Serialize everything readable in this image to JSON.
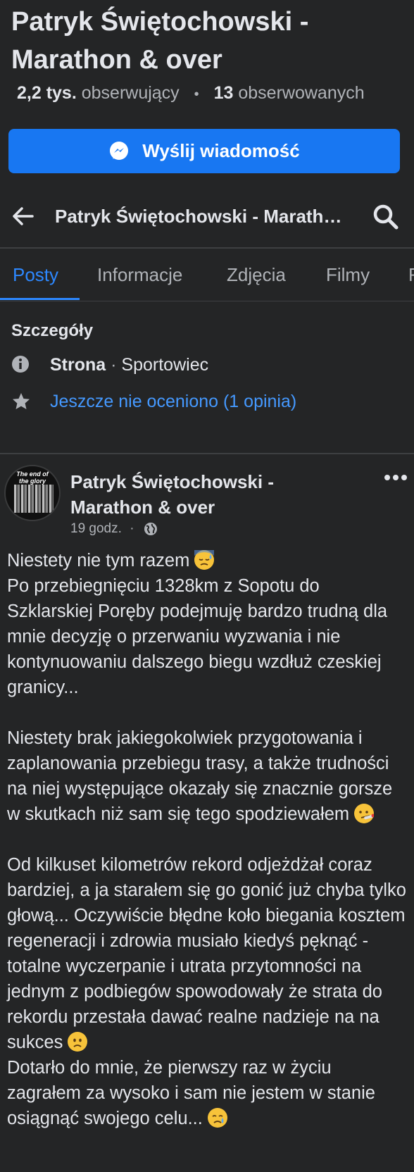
{
  "page": {
    "title": "Patryk Świętochowski - Marathon & over",
    "followers_count": "2,2 tys.",
    "followers_label": "obserwujący",
    "following_count": "13",
    "following_label": "obserwowanych",
    "message_button": "Wyślij wiadomość"
  },
  "navbar": {
    "title": "Patryk Świętochowski - Marathon & over"
  },
  "tabs": [
    {
      "label": "Posty",
      "active": true
    },
    {
      "label": "Informacje",
      "active": false
    },
    {
      "label": "Zdjęcia",
      "active": false
    },
    {
      "label": "Filmy",
      "active": false
    },
    {
      "label": "R",
      "active": false
    }
  ],
  "details": {
    "heading": "Szczegóły",
    "type_label": "Strona",
    "type_separator": "·",
    "category": "Sportowiec",
    "rating": "Jeszcze nie oceniono (1 opinia)"
  },
  "post": {
    "avatar_text": "The end of the glory",
    "author": "Patryk Świętochowski - Marathon & over",
    "time": "19 godz.",
    "meta_separator": "·",
    "paragraphs": [
      "Niestety nie tym razem",
      "Po przebiegnięciu 1328km z Sopotu do Szklarskiej Poręby podejmuję bardzo trudną dla mnie decyzję o przerwaniu wyzwania i nie kontynuowaniu dalszego biegu wzdłuż czeskiej granicy...",
      "Niestety brak jakiegokolwiek przygotowania i zaplanowania przebiegu trasy, a także trudności na niej występujące okazały się znacznie gorsze w skutkach niż sam się tego spodziewałem",
      "Od kilkuset kilometrów rekord odjeżdżał coraz bardziej, a ja starałem się go gonić już chyba tylko głową... Oczywiście błędne koło biegania kosztem regeneracji i zdrowia musiało kiedyś pęknąć - totalne wyczerpanie i utrata przytomności na jednym z podbiegów spowodowały że strata do rekordu przestała dawać realne nadzieje na na sukces",
      "Dotarło do mnie, że pierwszy raz w życiu zagrałem za wysoko i sam nie jestem w stanie osiągnąć swojego celu..."
    ]
  },
  "colors": {
    "background": "#242526",
    "accent": "#1877f2",
    "link": "#4599ff",
    "secondary_text": "#b0b3b8"
  },
  "icons": [
    "messenger-icon",
    "back-arrow-icon",
    "search-icon",
    "info-icon",
    "star-icon",
    "globe-icon",
    "more-dots-icon",
    "downcast-sweat-emoji",
    "thermometer-face-emoji",
    "slightly-frowning-emoji",
    "crying-face-emoji"
  ]
}
